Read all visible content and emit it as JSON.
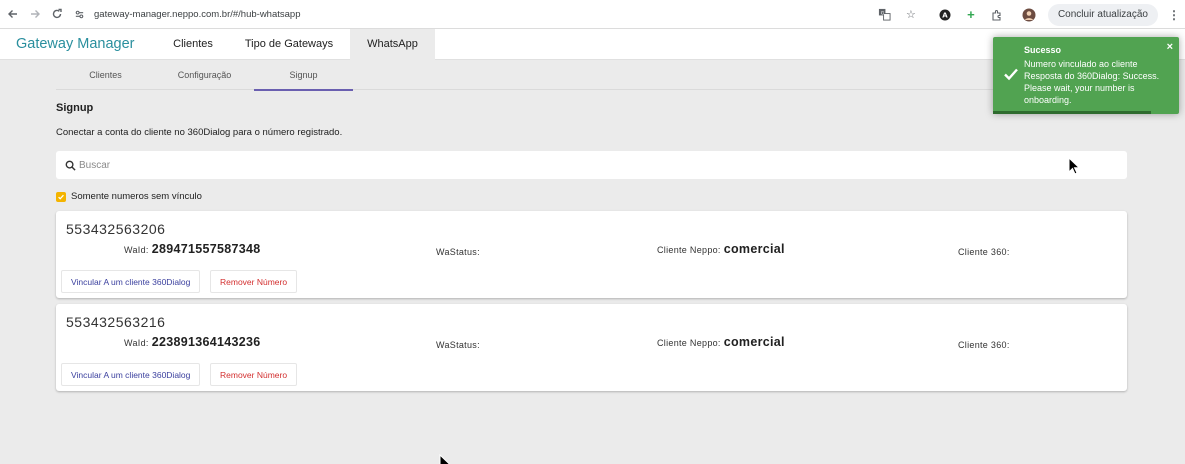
{
  "browser": {
    "url": "gateway-manager.neppo.com.br/#/hub-whatsapp",
    "update_label": "Concluir atualização"
  },
  "header": {
    "brand": "Gateway Manager",
    "tabs": [
      {
        "label": "Clientes"
      },
      {
        "label": "Tipo de Gateways"
      },
      {
        "label": "WhatsApp"
      }
    ]
  },
  "subtabs": [
    {
      "label": "Clientes"
    },
    {
      "label": "Configuração"
    },
    {
      "label": "Signup"
    }
  ],
  "section": {
    "title": "Signup",
    "description": "Conectar a conta do cliente no 360Dialog para o número registrado."
  },
  "search": {
    "placeholder": "Buscar",
    "value": ""
  },
  "filter": {
    "label": "Somente numeros sem vínculo",
    "checked": true
  },
  "labels": {
    "waid": "WaId:",
    "wastatus": "WaStatus:",
    "cliente_neppo": "Cliente Neppo:",
    "cliente_360": "Cliente 360:",
    "link_button": "Vincular A um cliente 360Dialog",
    "remove_button": "Remover Número"
  },
  "cards": [
    {
      "number": "553432563206",
      "waid": "289471557587348",
      "wastatus": "",
      "cliente_neppo": "comercial",
      "cliente_360": ""
    },
    {
      "number": "553432563216",
      "waid": "223891364143236",
      "wastatus": "",
      "cliente_neppo": "comercial",
      "cliente_360": ""
    }
  ],
  "toast": {
    "title": "Sucesso",
    "message": "Numero vinculado ao cliente Resposta do 360Dialog: Success. Please wait, your number is onboarding.",
    "close": "×",
    "progress": 0.85
  },
  "colors": {
    "brand": "#2a8f9e",
    "toast": "#51a351",
    "checkbox": "#f4b400",
    "link_button": "#3a3f9e",
    "remove_button": "#d32f2f",
    "active_tab_underline": "#6a5fb0"
  }
}
